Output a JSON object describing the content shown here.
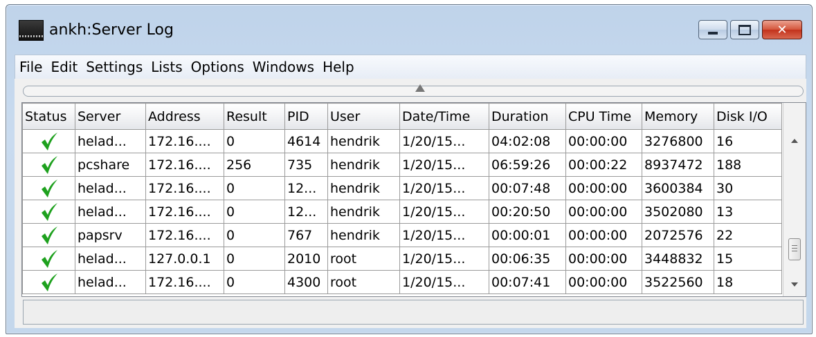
{
  "window": {
    "title": "ankh:Server Log",
    "close_label": "✕"
  },
  "menu": [
    "File",
    "Edit",
    "Settings",
    "Lists",
    "Options",
    "Windows",
    "Help"
  ],
  "columns": [
    "Status",
    "Server",
    "Address",
    "Result",
    "PID",
    "User",
    "Date/Time",
    "Duration",
    "CPU Time",
    "Memory",
    "Disk I/O"
  ],
  "rows": [
    {
      "status": "ok",
      "server": "helad...",
      "address": "172.16....",
      "result": "0",
      "pid": "4614",
      "user": "hendrik",
      "datetime": "1/20/15...",
      "duration": "04:02:08",
      "cpu": "00:00:00",
      "memory": "3276800",
      "disk": "16"
    },
    {
      "status": "ok",
      "server": "pcshare",
      "address": "172.16....",
      "result": "256",
      "pid": "735",
      "user": "hendrik",
      "datetime": "1/20/15...",
      "duration": "06:59:26",
      "cpu": "00:00:22",
      "memory": "8937472",
      "disk": "188"
    },
    {
      "status": "ok",
      "server": "helad...",
      "address": "172.16....",
      "result": "0",
      "pid": "12...",
      "user": "hendrik",
      "datetime": "1/20/15...",
      "duration": "00:07:48",
      "cpu": "00:00:00",
      "memory": "3600384",
      "disk": "30"
    },
    {
      "status": "ok",
      "server": "helad...",
      "address": "172.16....",
      "result": "0",
      "pid": "12...",
      "user": "hendrik",
      "datetime": "1/20/15...",
      "duration": "00:20:50",
      "cpu": "00:00:00",
      "memory": "3502080",
      "disk": "13"
    },
    {
      "status": "ok",
      "server": "papsrv",
      "address": "172.16....",
      "result": "0",
      "pid": "767",
      "user": "hendrik",
      "datetime": "1/20/15...",
      "duration": "00:00:01",
      "cpu": "00:00:00",
      "memory": "2072576",
      "disk": "22"
    },
    {
      "status": "ok",
      "server": "helad...",
      "address": "127.0.0.1",
      "result": "0",
      "pid": "2010",
      "user": "root",
      "datetime": "1/20/15...",
      "duration": "00:06:35",
      "cpu": "00:00:00",
      "memory": "3448832",
      "disk": "15"
    },
    {
      "status": "ok",
      "server": "helad...",
      "address": "172.16....",
      "result": "0",
      "pid": "4300",
      "user": "root",
      "datetime": "1/20/15...",
      "duration": "00:07:41",
      "cpu": "00:00:00",
      "memory": "3522560",
      "disk": "18"
    }
  ],
  "icons": {
    "status_ok": "check-icon",
    "check_color": "#1ea11e"
  },
  "status_bar": {
    "text": ""
  }
}
